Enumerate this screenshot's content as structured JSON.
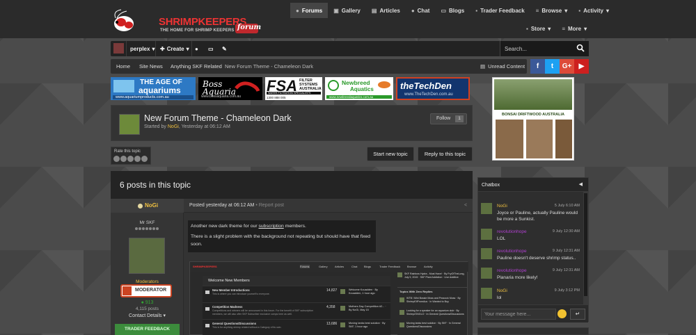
{
  "colors": {
    "accent": "#c0282d",
    "username": "#f0c040",
    "chat_purple": "#b040d0",
    "facebook": "#3b5998",
    "twitter": "#1da1f2",
    "googleplus": "#dd4b39",
    "youtube": "#cd201f"
  },
  "logo": {
    "name": "SHRIMPKEEPERS",
    "tagline": "THE HOME FOR SHRIMP KEEPERS",
    "forum_word": "forum",
    "com": ".com"
  },
  "nav": {
    "items": [
      {
        "label": "Forums",
        "icon": "comments-icon"
      },
      {
        "label": "Gallery",
        "icon": "camera-icon"
      },
      {
        "label": "Articles",
        "icon": "file-icon"
      },
      {
        "label": "Chat",
        "icon": "chat-icon"
      },
      {
        "label": "Blogs",
        "icon": "folder-icon"
      },
      {
        "label": "Trader Feedback",
        "icon": "people-icon"
      },
      {
        "label": "Browse",
        "icon": "list-icon"
      },
      {
        "label": "Activity",
        "icon": "user-icon"
      }
    ],
    "row2": [
      {
        "label": "Store",
        "icon": "cart-icon"
      },
      {
        "label": "More",
        "icon": "list-icon"
      }
    ]
  },
  "userbar": {
    "username": "perplex",
    "create": "Create"
  },
  "search": {
    "placeholder": "Search..."
  },
  "breadcrumb": [
    "Home",
    "Site News",
    "Anything SKF Related",
    "New Forum Theme - Chameleon Dark"
  ],
  "unread": "Unread Content",
  "social": [
    "f",
    "t",
    "G+",
    "▶"
  ],
  "ads": {
    "age": {
      "line1": "THE AGE OF",
      "line2": "aquariums",
      "url": "www.aquariumproducts.com.au"
    },
    "boss": {
      "text": "Boss Aquaria",
      "url": "www.bossaquaria.com.au"
    },
    "fsa": {
      "big": "FSA",
      "line1": "FILTER",
      "line2": "SYSTEMS",
      "line3": "AUSTRALIA",
      "line4": "WATER FILTRATION SPECIALISTS",
      "phone": "1300 888 005"
    },
    "newbreed": {
      "line1": "Newbreed",
      "line2": "Aquatics",
      "url": "www.newbreedaquatics.com.au"
    },
    "techden": {
      "text": "theTechDen",
      "url": "www.TheTechDen.com.au"
    },
    "bonsai": "BONSAI DRIFTWOOD AUSTRALIA"
  },
  "topic": {
    "title": "New Forum Theme - Chameleon Dark",
    "started_prefix": "Started by",
    "author": "NoGi",
    "date": "Yesterday at 06:12 AM",
    "follow_label": "Follow",
    "follow_count": "1",
    "rate_label": "Rate this topic",
    "rating": 0,
    "start_new": "Start new topic",
    "reply": "Reply to this topic"
  },
  "posts": {
    "heading": "6 posts in this topic",
    "first": {
      "author": "NoGi",
      "member_title": "Mr SKF",
      "role": "Moderators",
      "badge": "MODERATOR",
      "reputation": "913",
      "post_count": "4,115 posts",
      "contact": "Contact Details",
      "trader": "TRADER FEEDBACK",
      "posted": "Posted yesterday at 06:12 AM",
      "report": "Report post",
      "text1_a": "Another new dark theme for our",
      "text1_link": "subscription",
      "text1_b": "members.",
      "text2": "There is a slight problem with the background not repeating but should have that fixed soon."
    }
  },
  "screenshot": {
    "tabs": [
      "Forums",
      "Gallery",
      "Articles",
      "Chat",
      "Blogs",
      "Trader Feedback",
      "Browse",
      "Activity"
    ],
    "welcome": "Welcome New Members",
    "rows": [
      {
        "title": "New Member Introductions",
        "sub": "This is where you can introduce yourself to everyone.",
        "count": "14,827",
        "last": "Welcome Kouadden · By Kouadden, 1 hour ago"
      },
      {
        "title": "Competition Madness",
        "sub": "Competitions and winners will be announced in this forum. For the benefit of SKF subscription members, we will also offer SKF Subscriber exclusive comps here as well.",
        "count": "4,358",
        "last": "Mothers Day Competition #2... · By NoGi, May 15"
      },
      {
        "title": "General Questions/Discussions",
        "sub": "This is for anything shrimp related without a Category of its own.",
        "count": "13,686",
        "last": "Moving tanks best solution · By SKF, 1 hour ago"
      }
    ],
    "side_top": "SKF Rainbow Hydra - Must Have! · By FryOfTheLong, July 9, 2015 · SKF Plant Addiction · Live Additive",
    "side_title": "Topics With Zero Replies",
    "side_items": [
      "WTB / Mini Bossie Moss and Peacock Moss · By ShrimpElfFromAus · In Wanted to Buy",
      "Looking for a speaker for an aquarium club · By Shrimp/ONGLO · In General Questions/Discussions",
      "Moving tanks best solution · By SKF · In General Questions/Discussions"
    ]
  },
  "chatbox": {
    "title": "Chatbox",
    "placeholder": "Your message here...",
    "send": "↵",
    "messages": [
      {
        "name": "NoGi",
        "time": "5 July 6:10 AM",
        "text": "Joyce or Pauline, actually Pauline would be more a Sunkist.",
        "color": "#f0c040"
      },
      {
        "name": "revolutionhope",
        "time": "9 July 12:30 AM",
        "text": "LOL",
        "color": "#b040d0"
      },
      {
        "name": "revolutionhope",
        "time": "9 July 12:31 AM",
        "text": "Pauline doesn't deserve shrimp status..",
        "color": "#b040d0"
      },
      {
        "name": "revolutionhope",
        "time": "9 July 12:31 AM",
        "text": "Planaria more likely!",
        "color": "#b040d0"
      },
      {
        "name": "NoGi",
        "time": "9 July 3:12 PM",
        "text": "lol",
        "color": "#f0c040"
      }
    ]
  }
}
